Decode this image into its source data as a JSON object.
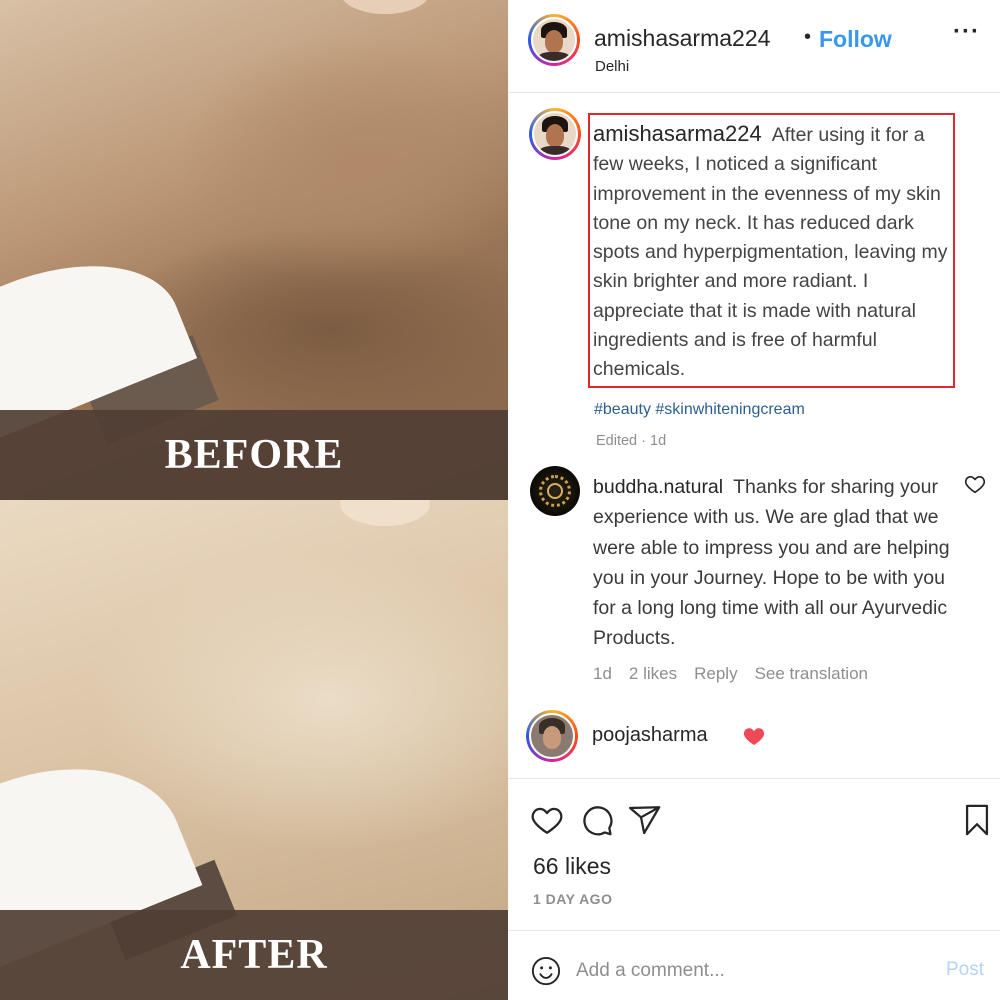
{
  "photo": {
    "before_label": "BEFORE",
    "after_label": "AFTER"
  },
  "header": {
    "username": "amishasarma224",
    "separator": "•",
    "follow_label": "Follow",
    "location": "Delhi",
    "more_label": "···"
  },
  "caption": {
    "username": "amishasarma224",
    "text": "After using it for a few weeks, I noticed a significant improvement in the evenness of my skin tone on my neck. It has reduced dark spots and hyperpigmentation, leaving my skin brighter and more radiant. I appreciate that it is made with natural ingredients and is free of harmful chemicals.",
    "hashtags": "#beauty #skinwhiteningcream",
    "edited": "Edited · 1d"
  },
  "comment": {
    "username": "buddha.natural",
    "text": "Thanks for sharing your experience with us. We are glad that we were able to impress you and are helping you in your Journey. Hope to be with you for a long long time with all our Ayurvedic Products.",
    "time": "1d",
    "likes": "2 likes",
    "reply": "Reply",
    "translation": "See translation"
  },
  "liker": {
    "username": "poojasharma"
  },
  "footer": {
    "likes": "66 likes",
    "time_ago": "1 DAY AGO",
    "comment_placeholder": "Add a comment...",
    "post_label": "Post"
  },
  "icons": {
    "like": "heart-outline",
    "comment": "speech-bubble",
    "share": "paper-plane",
    "save": "bookmark",
    "emoji": "smiley",
    "liked": "heart-red"
  },
  "colors": {
    "follow": "#3897f0",
    "highlight_box": "#e0292c",
    "hashtag": "#2c5f90",
    "heart": "#ed4956",
    "post_disabled": "#b3d4f5"
  }
}
